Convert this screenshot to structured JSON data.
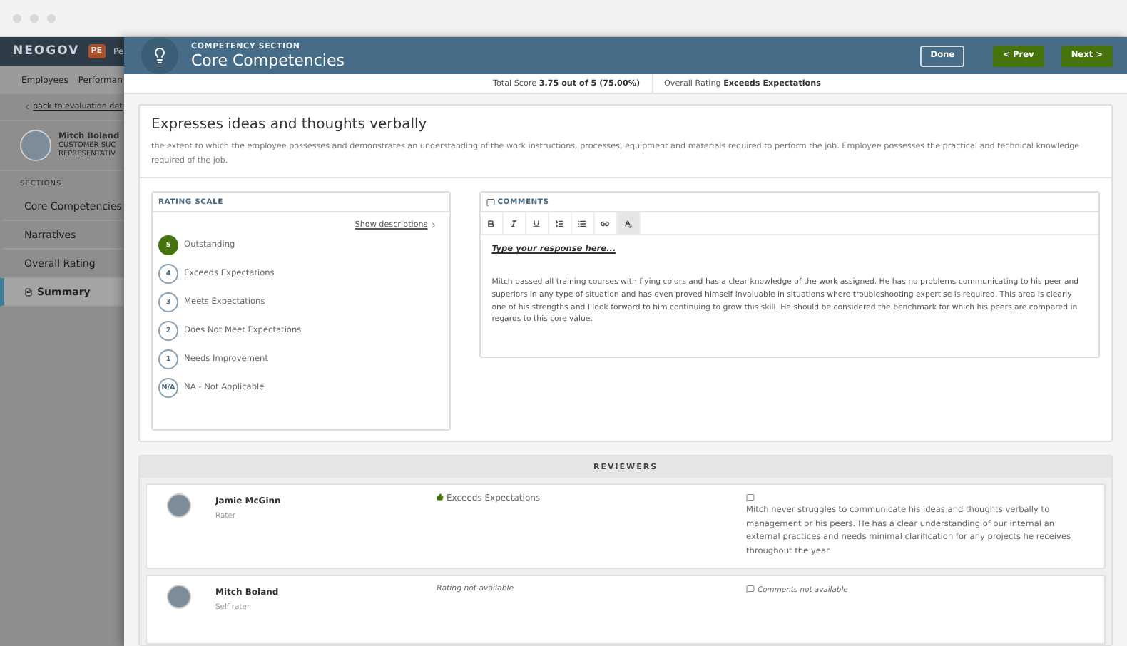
{
  "background_app": {
    "logo": "NEOGOV",
    "badge": "PE",
    "badge_text": "Pe",
    "nav": [
      "Employees",
      "Performan"
    ],
    "back_link": "back to evaluation det",
    "profile": {
      "name": "Mitch Boland",
      "title_lines": [
        "CUSTOMER SUC",
        "REPRESENTATIV"
      ]
    },
    "sections_label": "SECTIONS",
    "sections": [
      {
        "label": "Core Competencies",
        "selected": false
      },
      {
        "label": "Narratives",
        "selected": false
      },
      {
        "label": "Overall Rating",
        "selected": false
      },
      {
        "label": "Summary",
        "selected": true
      }
    ]
  },
  "header": {
    "eyebrow": "COMPETENCY SECTION",
    "title": "Core Competencies",
    "buttons": [
      {
        "label": "Done",
        "kind": "outline"
      },
      {
        "label": "< Prev",
        "kind": "primary"
      },
      {
        "label": "Next >",
        "kind": "primary"
      }
    ]
  },
  "score_bar": [
    {
      "label": "Total Score",
      "value": "3.75 out of 5 (75.00%)"
    },
    {
      "label": "Overall Rating",
      "value": "Exceeds Expectations"
    }
  ],
  "competency": {
    "title": "Expresses ideas and thoughts verbally",
    "description": "the extent to which the employee possesses and demonstrates an understanding of the work instructions, processes, equipment and materials required to perform the job. Employee possesses the practical and technical knowledge required of the job."
  },
  "rating_scale": {
    "title": "RATING SCALE",
    "show_link": "Show descriptions",
    "ratings": [
      {
        "number": "5",
        "label": "Outstanding",
        "selected": true
      },
      {
        "number": "4",
        "label": "Exceeds Expectations",
        "selected": false
      },
      {
        "number": "3",
        "label": "Meets Expectations",
        "selected": false
      },
      {
        "number": "2",
        "label": "Does Not Meet Expectations",
        "selected": false
      },
      {
        "number": "1",
        "label": "Needs Improvement",
        "selected": false
      },
      {
        "number": "N/A",
        "label": "NA - Not Applicable",
        "selected": false
      }
    ]
  },
  "comments": {
    "title": "COMMENTS",
    "toolbar": [
      {
        "kind": "bold",
        "selected": false
      },
      {
        "kind": "italic",
        "selected": false
      },
      {
        "kind": "underline",
        "selected": false
      },
      {
        "kind": "ordered-list",
        "selected": false
      },
      {
        "kind": "bullet-list",
        "selected": false
      },
      {
        "kind": "link",
        "selected": false
      },
      {
        "kind": "spellcheck",
        "selected": true
      }
    ],
    "prompt": "Type your response here...",
    "text": "Mitch passed all training courses with flying colors and has a clear knowledge of the work assigned.  He has no problems communicating to his peer and superiors in any type of situation and has even proved himself invaluable in situations where troubleshooting expertise is required.  This area is clearly one of his strengths and I look forward to him continuing to grow this skill.  He should be considered the benchmark for which his peers are compared in regards to this core value."
  },
  "reviewers": {
    "title": "REVIEWERS",
    "items": [
      {
        "name": "Jamie McGinn",
        "role": "Rater",
        "rating": "Exceeds Expectations",
        "rating_available": true,
        "comment": "Mitch never struggles to communicate his ideas and thoughts verbally to management or his peers.  He has a clear understanding of our internal an external practices and needs minimal clarification for any projects he receives throughout the year.",
        "comment_available": true
      },
      {
        "name": "Mitch Boland",
        "role": "Self rater",
        "rating": "Rating not available",
        "rating_available": false,
        "comment": "Comments not available",
        "comment_available": false
      }
    ]
  }
}
